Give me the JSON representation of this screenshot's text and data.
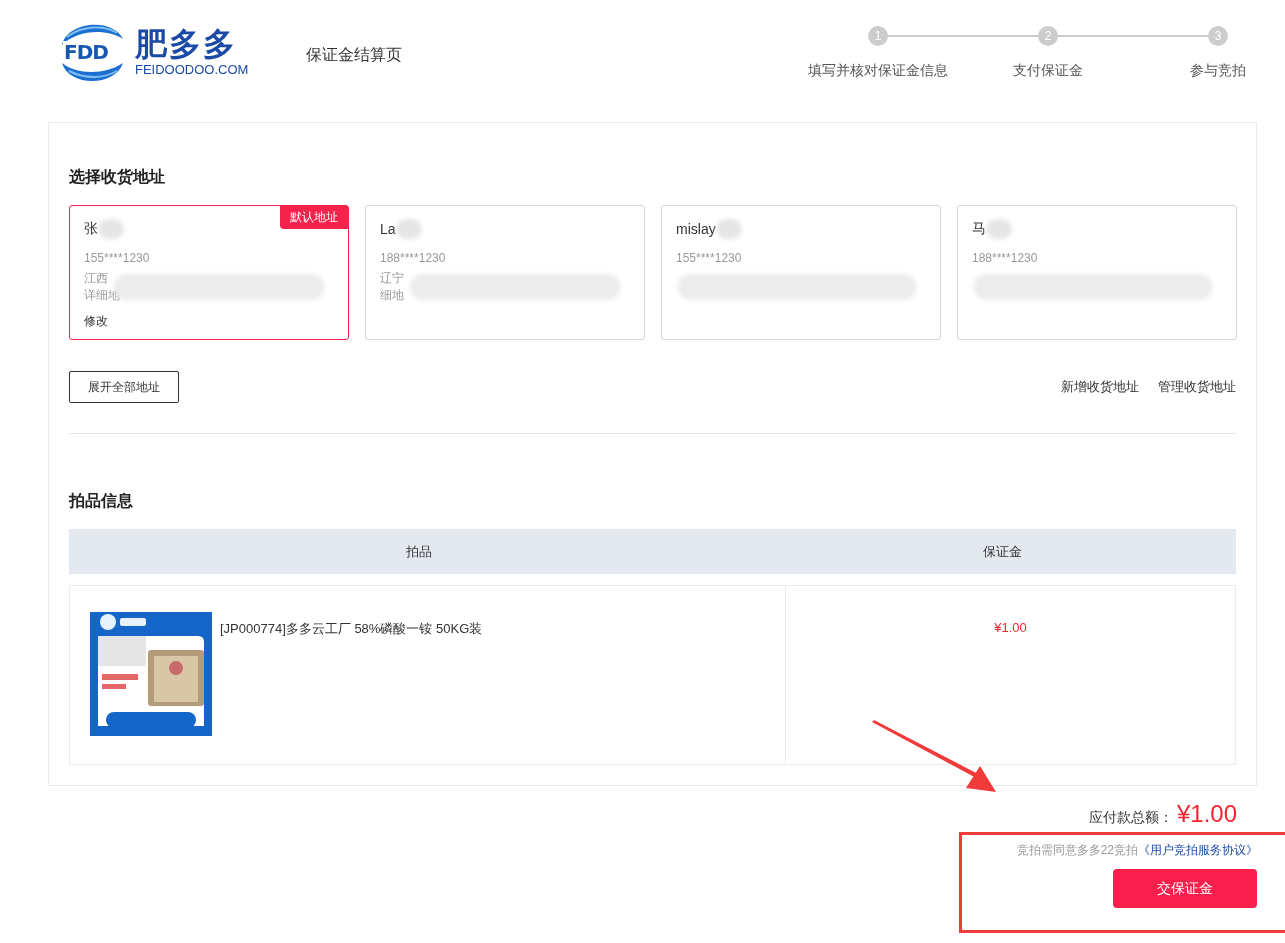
{
  "header": {
    "logo": {
      "mark": "FDD",
      "name": "肥多多",
      "domain": "FEIDOODOO.COM"
    },
    "page_title": "保证金结算页",
    "steps": [
      {
        "number": "1",
        "label": "填写并核对保证金信息"
      },
      {
        "number": "2",
        "label": "支付保证金"
      },
      {
        "number": "3",
        "label": "参与竞拍"
      }
    ]
  },
  "address_section": {
    "title": "选择收货地址",
    "addresses": [
      {
        "name": "张",
        "phone": "155****1230",
        "address_lines": [
          "江西",
          "详细地"
        ],
        "badge": "默认地址",
        "edit_link": "修改",
        "selected": true
      },
      {
        "name": "La",
        "phone": "188****1230",
        "address_lines": [
          "辽宁",
          "细地"
        ],
        "selected": false
      },
      {
        "name": "mislay",
        "phone": "155****1230",
        "selected": false
      },
      {
        "name": "马",
        "phone": "188****1230",
        "selected": false
      }
    ],
    "expand_button": "展开全部地址",
    "links": [
      "新增收货地址",
      "管理收货地址"
    ]
  },
  "items_section": {
    "title": "拍品信息",
    "columns": [
      "拍品",
      "保证金"
    ],
    "rows": [
      {
        "name": "[JP000774]多多云工厂 58%磷酸一铵 50KG装",
        "deposit": "¥1.00"
      }
    ]
  },
  "summary": {
    "total_label": "应付款总额：",
    "total": "¥1.00",
    "agreement_text": "竞拍需同意多多22竞拍",
    "agreement_link": "《用户竞拍服务协议》",
    "submit_button": "交保证金"
  }
}
